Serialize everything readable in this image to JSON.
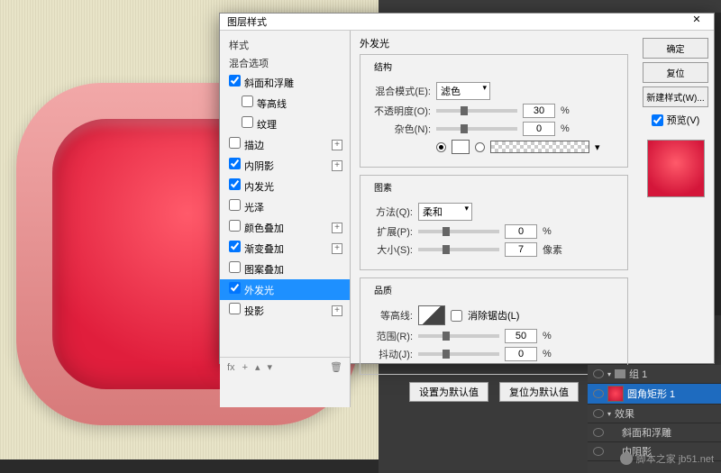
{
  "dialog": {
    "title": "图层样式",
    "close": "✕",
    "styleHeader1": "样式",
    "styleHeader2": "混合选项",
    "items": [
      {
        "label": "斜面和浮雕",
        "checked": true,
        "sub": false,
        "plus": false
      },
      {
        "label": "等高线",
        "checked": false,
        "sub": true,
        "plus": false
      },
      {
        "label": "纹理",
        "checked": false,
        "sub": true,
        "plus": false
      },
      {
        "label": "描边",
        "checked": false,
        "sub": false,
        "plus": true
      },
      {
        "label": "内阴影",
        "checked": true,
        "sub": false,
        "plus": true
      },
      {
        "label": "内发光",
        "checked": true,
        "sub": false,
        "plus": false
      },
      {
        "label": "光泽",
        "checked": false,
        "sub": false,
        "plus": false
      },
      {
        "label": "颜色叠加",
        "checked": false,
        "sub": false,
        "plus": true
      },
      {
        "label": "渐变叠加",
        "checked": true,
        "sub": false,
        "plus": true
      },
      {
        "label": "图案叠加",
        "checked": false,
        "sub": false,
        "plus": false
      },
      {
        "label": "外发光",
        "checked": true,
        "sub": false,
        "plus": false,
        "selected": true
      },
      {
        "label": "投影",
        "checked": false,
        "sub": false,
        "plus": true
      }
    ],
    "fx": "fx",
    "trash": "🗑"
  },
  "outerGlow": {
    "title": "外发光",
    "struct": {
      "legend": "结构",
      "blendMode": {
        "label": "混合模式(E):",
        "value": "滤色"
      },
      "opacity": {
        "label": "不透明度(O):",
        "value": "30",
        "unit": "%"
      },
      "noise": {
        "label": "杂色(N):",
        "value": "0",
        "unit": "%"
      }
    },
    "elements": {
      "legend": "图素",
      "method": {
        "label": "方法(Q):",
        "value": "柔和"
      },
      "spread": {
        "label": "扩展(P):",
        "value": "0",
        "unit": "%"
      },
      "size": {
        "label": "大小(S):",
        "value": "7",
        "unit": "像素"
      }
    },
    "quality": {
      "legend": "品质",
      "contour": "等高线:",
      "antialias": "消除锯齿(L)",
      "range": {
        "label": "范围(R):",
        "value": "50",
        "unit": "%"
      },
      "jitter": {
        "label": "抖动(J):",
        "value": "0",
        "unit": "%"
      }
    },
    "setDefault": "设置为默认值",
    "resetDefault": "复位为默认值"
  },
  "buttons": {
    "ok": "确定",
    "cancel": "复位",
    "newStyle": "新建样式(W)...",
    "preview": "预览(V)"
  },
  "layers": {
    "group": "组 1",
    "layer": "圆角矩形 1",
    "effects": "效果",
    "bevel": "斜面和浮雕",
    "innerGlow": "内阴影"
  },
  "watermark": "脚本之家 jb51.net"
}
